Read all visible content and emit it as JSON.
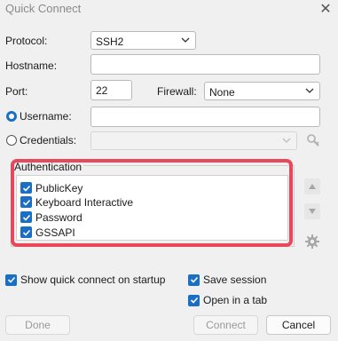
{
  "window": {
    "title": "Quick Connect",
    "close_glyph": "✕"
  },
  "form": {
    "protocol_label": "Protocol:",
    "protocol_value": "SSH2",
    "hostname_label": "Hostname:",
    "hostname_value": "",
    "port_label": "Port:",
    "port_value": "22",
    "firewall_label": "Firewall:",
    "firewall_value": "None",
    "username_label": "Username:",
    "username_value": "",
    "credentials_label": "Credentials:",
    "credentials_value": ""
  },
  "auth": {
    "title": "Authentication",
    "items": [
      {
        "label": "PublicKey",
        "checked": true
      },
      {
        "label": "Keyboard Interactive",
        "checked": true
      },
      {
        "label": "Password",
        "checked": true
      },
      {
        "label": "GSSAPI",
        "checked": true
      }
    ],
    "move_up_icon": "triangle-up-icon",
    "move_down_icon": "triangle-down-icon",
    "settings_icon": "gear-icon"
  },
  "options": {
    "show_on_startup": "Show quick connect on startup",
    "save_session": "Save session",
    "open_in_tab": "Open in a tab"
  },
  "buttons": {
    "done": "Done",
    "connect": "Connect",
    "cancel": "Cancel"
  },
  "colors": {
    "accent": "#1a6fc4",
    "highlight": "#e8475c"
  }
}
